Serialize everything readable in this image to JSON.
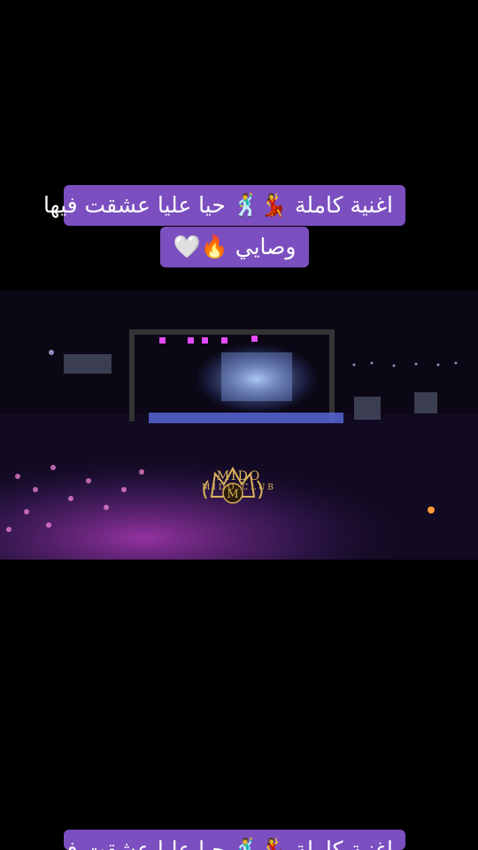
{
  "caption": {
    "line1": "اغنية كاملة 💃🕺 حيا عليا عشقت فيها",
    "line2": "وصايي 🔥🤍",
    "line3": "اغنية كاملة 💃🕺 حيا عليا عشقت فيها"
  },
  "video": {
    "logo_title": "MIDO",
    "logo_subtitle": "MIDO CLUB",
    "logo_letter": "M"
  },
  "colors": {
    "caption_bg": "#7b4fc0",
    "logo_gold": "#d9b25b",
    "background": "#000000"
  },
  "icons": [
    "stage-lights-icon",
    "crown-logo-icon"
  ]
}
